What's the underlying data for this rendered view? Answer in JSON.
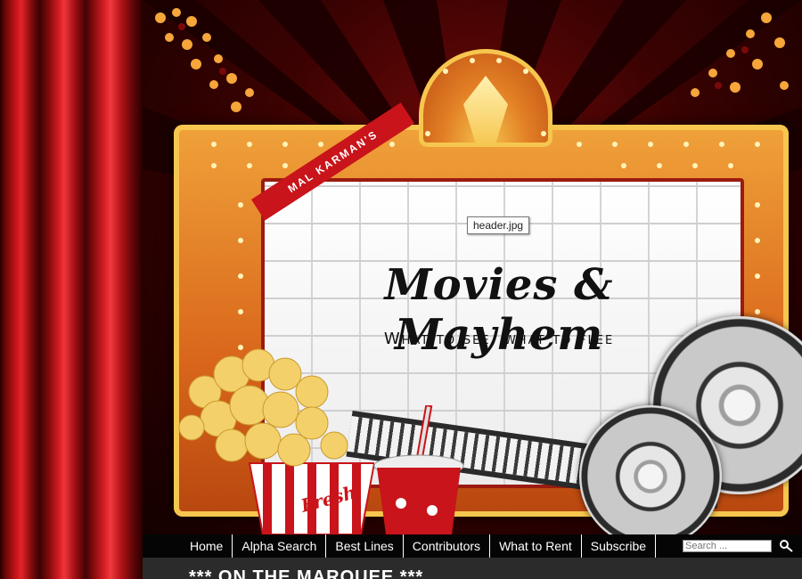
{
  "header": {
    "sash_text": "MAL KARMAN'S",
    "site_title": "Movies & Mayhem",
    "tagline": "What to see, what to flee",
    "image_tooltip": "header.jpg",
    "popcorn_box_label": "Fresh"
  },
  "nav": {
    "items": [
      {
        "label": "Home"
      },
      {
        "label": "Alpha Search"
      },
      {
        "label": "Best Lines"
      },
      {
        "label": "Contributors"
      },
      {
        "label": "What to Rent"
      },
      {
        "label": "Subscribe"
      }
    ],
    "search_placeholder": "Search ...",
    "search_icon": "magnifier-icon"
  },
  "content": {
    "section_heading": "*** ON THE MARQUEE ***"
  },
  "colors": {
    "curtain": "#c8141a",
    "navbar_bg": "#050505",
    "marquee_gold": "#f6c64f",
    "marquee_orange": "#d9661b",
    "content_bg": "#2b2b2b"
  }
}
